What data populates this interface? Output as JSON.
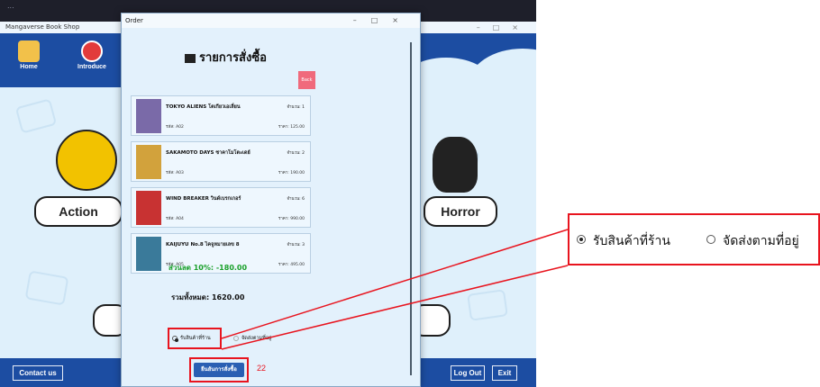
{
  "background_window": {
    "top_caption": "...",
    "title": "Mangaverse Book Shop",
    "nav": [
      {
        "label": "Home"
      },
      {
        "label": "Introduce"
      }
    ],
    "genres": [
      "Action",
      "Horror"
    ],
    "bottom_buttons": {
      "contact": "Contact us",
      "logout": "Log Out",
      "exit": "Exit"
    }
  },
  "order": {
    "window_title": "Order",
    "heading": "รายการสั่งซื้อ",
    "back_label": "Back",
    "items": [
      {
        "title": "TOKYO ALIENS โตเกียวเอเลี่ยน",
        "qty": "จำนวน: 1",
        "code": "รหัส: A02",
        "price": "ราคา: 125.00",
        "cover_color": "#7a6aa8"
      },
      {
        "title": "SAKAMOTO DAYS ซาคาโมโตะเดย์",
        "qty": "จำนวน: 2",
        "code": "รหัส: A03",
        "price": "ราคา: 190.00",
        "cover_color": "#d2a23c"
      },
      {
        "title": "WIND BREAKER วินด์เบรกเกอร์",
        "qty": "จำนวน: 6",
        "code": "รหัส: A04",
        "price": "ราคา: 990.00",
        "cover_color": "#c83232"
      },
      {
        "title": "KAIJUYU No.8 ไคจูหมายเลข 8",
        "qty": "จำนวน: 3",
        "code": "รหัส: A05",
        "price": "ราคา: 495.00",
        "cover_color": "#3a7a9a"
      }
    ],
    "discount_text": "ส่วนลด 10%: -180.00",
    "total_text": "รวมทั้งหมด: 1620.00",
    "delivery_options": [
      {
        "label": "รับสินค้าที่ร้าน",
        "selected": true
      },
      {
        "label": "จัดส่งตามที่อยู่",
        "selected": false
      }
    ],
    "confirm_label": "ยืนยันการสั่งซื้อ"
  },
  "annotation": {
    "step_number": "22",
    "zoom_options": [
      {
        "label": "รับสินค้าที่ร้าน",
        "selected": true
      },
      {
        "label": "จัดส่งตามที่อยู่",
        "selected": false
      }
    ]
  },
  "colors": {
    "nav_blue": "#1c4da2",
    "dialog_bg": "#e3f1fc",
    "highlight": "#e8141e",
    "discount_green": "#19a02a",
    "back_pink": "#f06a7c"
  }
}
